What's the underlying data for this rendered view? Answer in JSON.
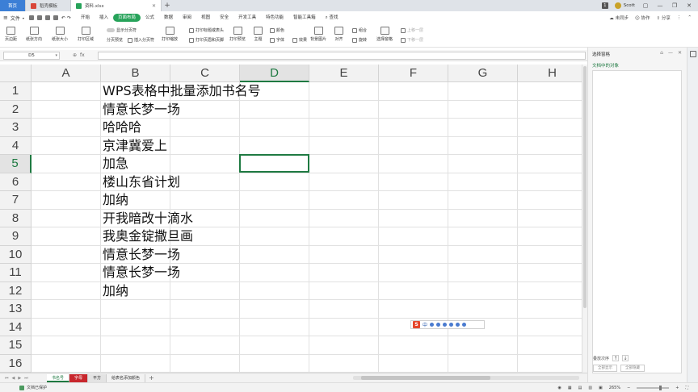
{
  "titlebar": {
    "tabs": [
      {
        "label": "首页"
      },
      {
        "label": "稻壳模板"
      },
      {
        "label": "资料.xlsx"
      }
    ],
    "user": "Scott",
    "badge": "1"
  },
  "menubar": {
    "file": "文件",
    "items": [
      "开始",
      "插入",
      "页面布局",
      "公式",
      "数据",
      "审阅",
      "视图",
      "安全",
      "开发工具",
      "特色功能",
      "智能工具箱"
    ],
    "active_index": 2,
    "search": "查找",
    "sync": "未同步",
    "collab": "协作",
    "share": "分享"
  },
  "toolbar": {
    "margins": "页边距",
    "orientation": "纸张方向",
    "size": "纸张大小",
    "print_area": "打印区域",
    "show_pagebreak": "显示分页符",
    "page_preview": "分页预览",
    "insert_pagebreak": "插入分页符",
    "print_scale": "打印缩放",
    "print_titles": "打印标题或表头",
    "header_footer": "打印页眉和页脚",
    "print_preview": "打印预览",
    "theme": "主题",
    "colors": "颜色",
    "fonts": "字体",
    "effects": "效果",
    "background": "背景图片",
    "align": "对齐",
    "group": "组合",
    "rotate": "旋转",
    "select_pane": "选择窗格",
    "bring_forward": "上移一层",
    "send_backward": "下移一层"
  },
  "formulabar": {
    "cell_ref": "D5",
    "fx": "fx",
    "value": ""
  },
  "grid": {
    "columns": [
      "A",
      "B",
      "C",
      "D",
      "E",
      "F",
      "G",
      "H"
    ],
    "selected_column": "D",
    "rows": [
      "1",
      "2",
      "3",
      "4",
      "5",
      "6",
      "7",
      "8",
      "9",
      "10",
      "11",
      "12",
      "13",
      "14",
      "15",
      "16"
    ],
    "selected_row": "5",
    "cells_B": [
      "WPS表格中批量添加书名号",
      "情意长梦一场",
      "哈哈哈",
      "京津冀爱上",
      "加急",
      "楼山东省计划",
      "加纳",
      "开我暗改十滴水",
      "我奥金锭撒旦画",
      "情意长梦一场",
      "情意长梦一场",
      "加纳"
    ]
  },
  "ime": {
    "logo": "S",
    "mode": "中"
  },
  "sheets": [
    "书名号",
    "字母",
    "平方",
    "给表名添加颜色"
  ],
  "statusbar": {
    "protect": "文档已保护",
    "zoom": "265%"
  },
  "pane": {
    "title": "选择窗格",
    "subtitle": "文档中的对象",
    "order": "叠放次序",
    "show_all": "全部显示",
    "hide_all": "全部隐藏"
  },
  "colors": {
    "accent": "#1f7a42",
    "active_tab": "#27a35a",
    "home_tab": "#3c7fd6",
    "sheet_red": "#c8272d"
  }
}
